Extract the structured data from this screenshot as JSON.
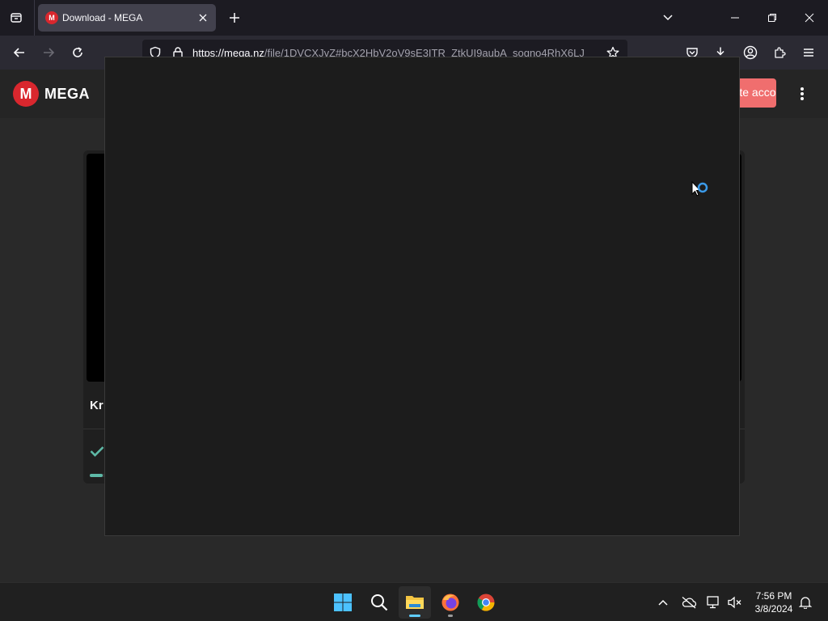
{
  "browser": {
    "tab": {
      "title": "Download - MEGA",
      "favicon_letter": "M"
    },
    "url": {
      "host": "https://mega.nz",
      "path": "/file/1DVCXJvZ#bcX2HbV2oV9sE3ITR_ZtkUI9aubA_soqno4RhX6LJ"
    }
  },
  "page": {
    "logo_letter": "M",
    "brand": "MEGA",
    "create_account_label": "Create account",
    "file_name_partial": "Kr",
    "progress": 0.02
  },
  "taskbar": {
    "apps": [
      "windows-start-icon",
      "search-icon",
      "file-explorer-icon",
      "firefox-icon",
      "chrome-icon"
    ],
    "clock": {
      "time": "7:56 PM",
      "date": "3/8/2024"
    }
  },
  "colors": {
    "mega_red": "#d9272e",
    "create_account": "#f06e6e",
    "progress": "#5eb9a7",
    "taskbar_accent": "#60cdff"
  }
}
